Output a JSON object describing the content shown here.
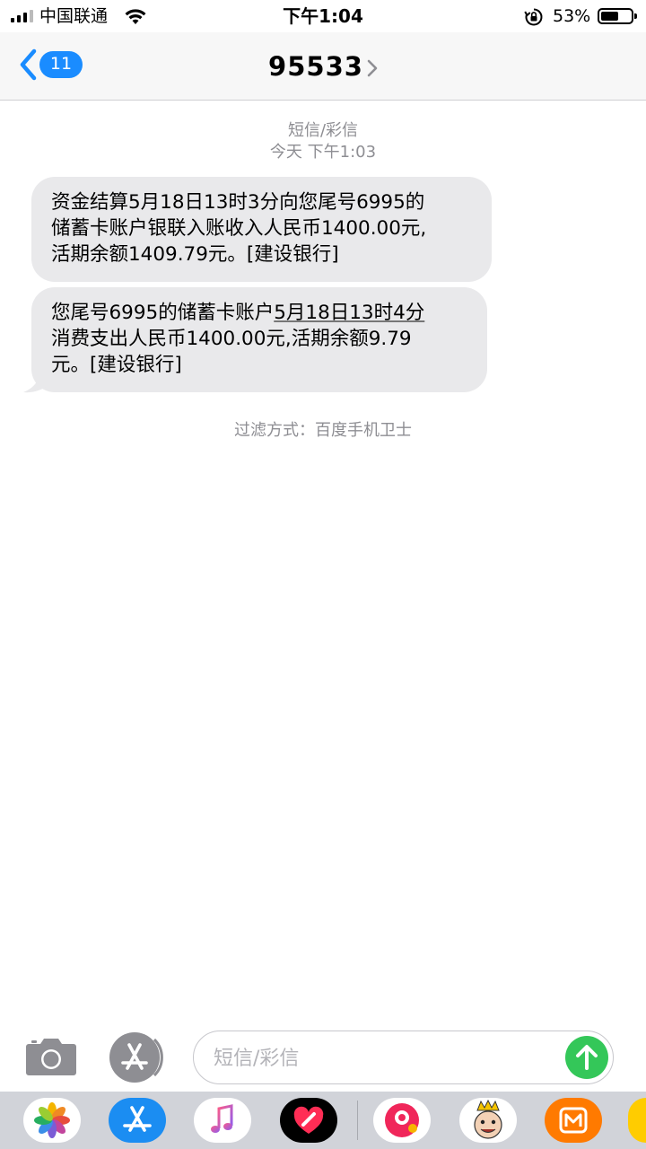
{
  "status_bar": {
    "carrier": "中国联通",
    "time": "下午1:04",
    "battery_percent": "53%",
    "battery_level": 0.53,
    "icons": [
      "signal-icon",
      "wifi-icon",
      "rotation-lock-icon",
      "battery-icon"
    ]
  },
  "nav": {
    "back_badge": "11",
    "title": "95533",
    "icons": [
      "back-chevron-icon",
      "title-chevron-icon"
    ]
  },
  "conversation": {
    "type_label": "短信/彩信",
    "timestamp": "今天 下午1:03",
    "messages": [
      {
        "line1": "资金结算5月18日13时3分向您尾号6995的",
        "line2": "储蓄卡账户银联入账收入人民币1400.00元,",
        "line3": "活期余额1409.79元。[建设银行]"
      },
      {
        "line1a": "您尾号6995的储蓄卡账户",
        "line1b": "5月18日13时4分",
        "line2": "消费支出人民币1400.00元,活期余额9.79",
        "line3": "元。[建设银行]"
      }
    ],
    "filter_note": "过滤方式：百度手机卫士"
  },
  "compose": {
    "placeholder": "短信/彩信",
    "icons": [
      "camera-icon",
      "app-store-icon",
      "send-arrow-icon"
    ]
  },
  "app_drawer": {
    "apps": [
      "photos-app-icon",
      "app-store-app-icon",
      "music-app-icon",
      "digital-touch-app-icon",
      "quiz-app-icon",
      "king-sticker-app-icon",
      "mango-tv-app-icon",
      "emoji-app-icon"
    ]
  },
  "colors": {
    "accent": "#1a8cff",
    "bubble": "#e9e9eb",
    "send": "#34c759",
    "meta_text": "#8e8e93"
  }
}
